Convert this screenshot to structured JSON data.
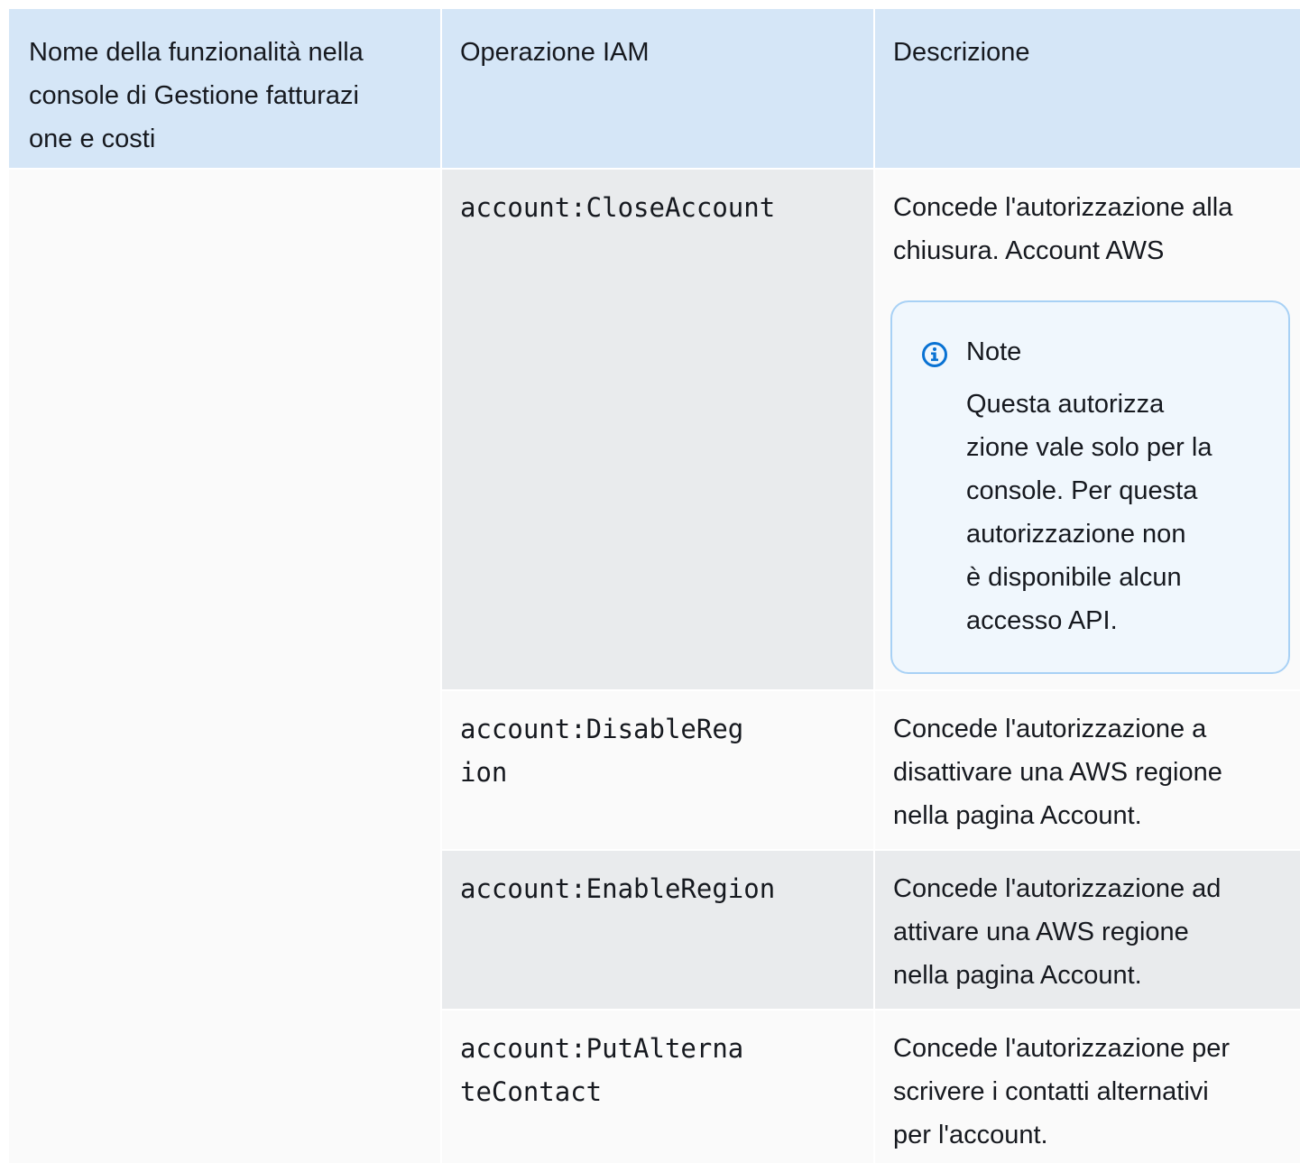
{
  "header": {
    "col1_lines": [
      "Nome della funzionalità nella",
      "console di Gestione fatturazi",
      "one e costi"
    ],
    "col2": "Operazione IAM",
    "col3": "Descrizione"
  },
  "rows": [
    {
      "operation_lines": [
        "account:CloseAccount"
      ],
      "description_lines": [
        "Concede l'autorizzazione alla",
        "chiusura. Account AWS"
      ],
      "note": {
        "title": "Note",
        "icon": "info-icon",
        "lines": [
          "Questa autorizza",
          "zione vale solo per la",
          "console. Per questa",
          "autorizzazione non",
          "è disponibile alcun",
          "accesso API."
        ]
      }
    },
    {
      "operation_lines": [
        "account:DisableReg",
        "ion"
      ],
      "description_lines": [
        "Concede l'autorizzazione a",
        "disattivare una AWS regione",
        "nella pagina Account."
      ]
    },
    {
      "operation_lines": [
        "account:EnableRegion"
      ],
      "description_lines": [
        "Concede l'autorizzazione ad",
        "attivare una AWS regione",
        "nella pagina Account."
      ]
    },
    {
      "operation_lines": [
        "account:PutAlterna",
        "teContact"
      ],
      "description_lines": [
        "Concede l'autorizzazione per",
        "scrivere i contatti alternativi",
        "per l'account."
      ]
    }
  ],
  "colors": {
    "header_bg": "#d5e6f7",
    "row_grey": "#e9ebed",
    "row_light": "#fafafa",
    "note_border": "#a8d1f5",
    "note_bg": "#f0f7fd",
    "info_icon": "#0972d3"
  }
}
